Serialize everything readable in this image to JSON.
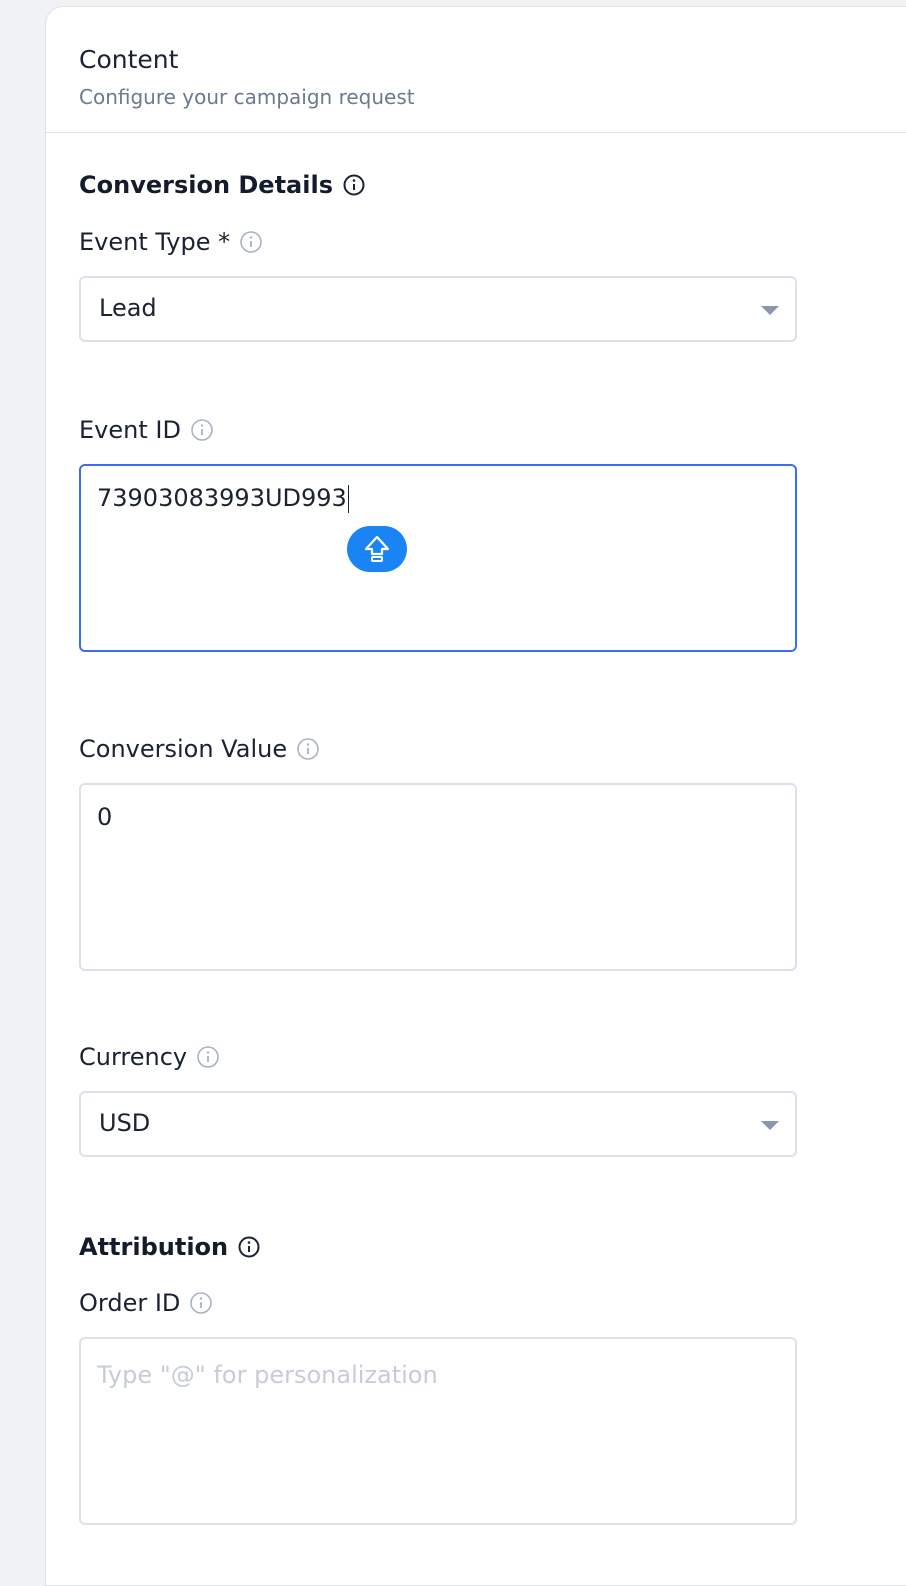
{
  "header": {
    "title": "Content",
    "subtitle": "Configure your campaign request"
  },
  "conversion_details": {
    "title": "Conversion Details",
    "event_type": {
      "label": "Event Type *",
      "value": "Lead"
    },
    "event_id": {
      "label": "Event ID",
      "value": "73903083993UD993"
    },
    "conversion_value": {
      "label": "Conversion Value",
      "value": "0"
    },
    "currency": {
      "label": "Currency",
      "value": "USD"
    }
  },
  "attribution": {
    "title": "Attribution",
    "order_id": {
      "label": "Order ID",
      "placeholder": "Type \"@\" for personalization",
      "value": ""
    }
  },
  "colors": {
    "focus_border": "#3a6df0",
    "shift_badge": "#1a84f5",
    "border": "#dde2ea",
    "muted_text": "#6b7a90"
  },
  "icons": {
    "info": "info-icon",
    "dropdown": "chevron-down-icon",
    "shift_key": "shift-key-icon"
  }
}
